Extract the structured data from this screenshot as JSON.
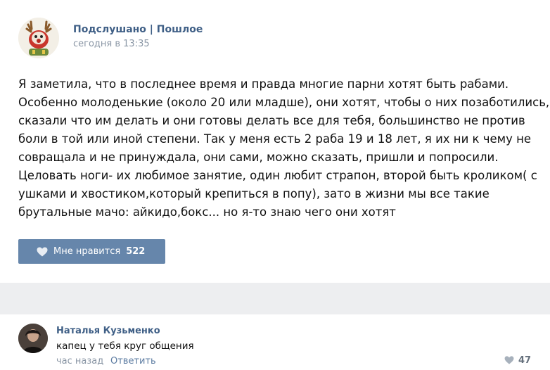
{
  "post": {
    "author": "Подслушано | Пошлое",
    "time": "сегодня в 13:35",
    "avatar_icon": "reindeer-avatar",
    "text_lines": [
      "Я заметила, что в последнее время и правда многие парни хотят быть рабами.",
      "Особенно молоденькие (около 20 или младше), они хотят, чтобы о них позаботились,",
      "сказали что им делать и они готовы делать все для тебя, большинство не против",
      "боли в той или иной степени. Так у меня есть 2 раба 19 и 18 лет, я их ни к чему не",
      "совращала и не принуждала, они сами, можно сказать, пришли и попросили.",
      "Целовать ноги- их любимое занятие, один любит страпон, второй быть кроликом( с",
      "ушками и хвостиком,который крепиться в попу), зато в жизни мы все такие",
      "брутальные мачо: айкидо,бокс... но я-то знаю чего они хотят"
    ],
    "like_button": {
      "label": "Мне нравится",
      "count": "522",
      "icon": "heart-icon"
    }
  },
  "comment": {
    "author": "Наталья Кузьменко",
    "text": "капец у тебя круг общения",
    "time": "час назад",
    "reply_label": "Ответить",
    "likes": "47",
    "like_icon": "heart-icon"
  },
  "colors": {
    "link": "#3f5f86",
    "like_button_bg": "#6686ab",
    "separator": "#edeef0",
    "meta_text": "#8a96a5"
  }
}
